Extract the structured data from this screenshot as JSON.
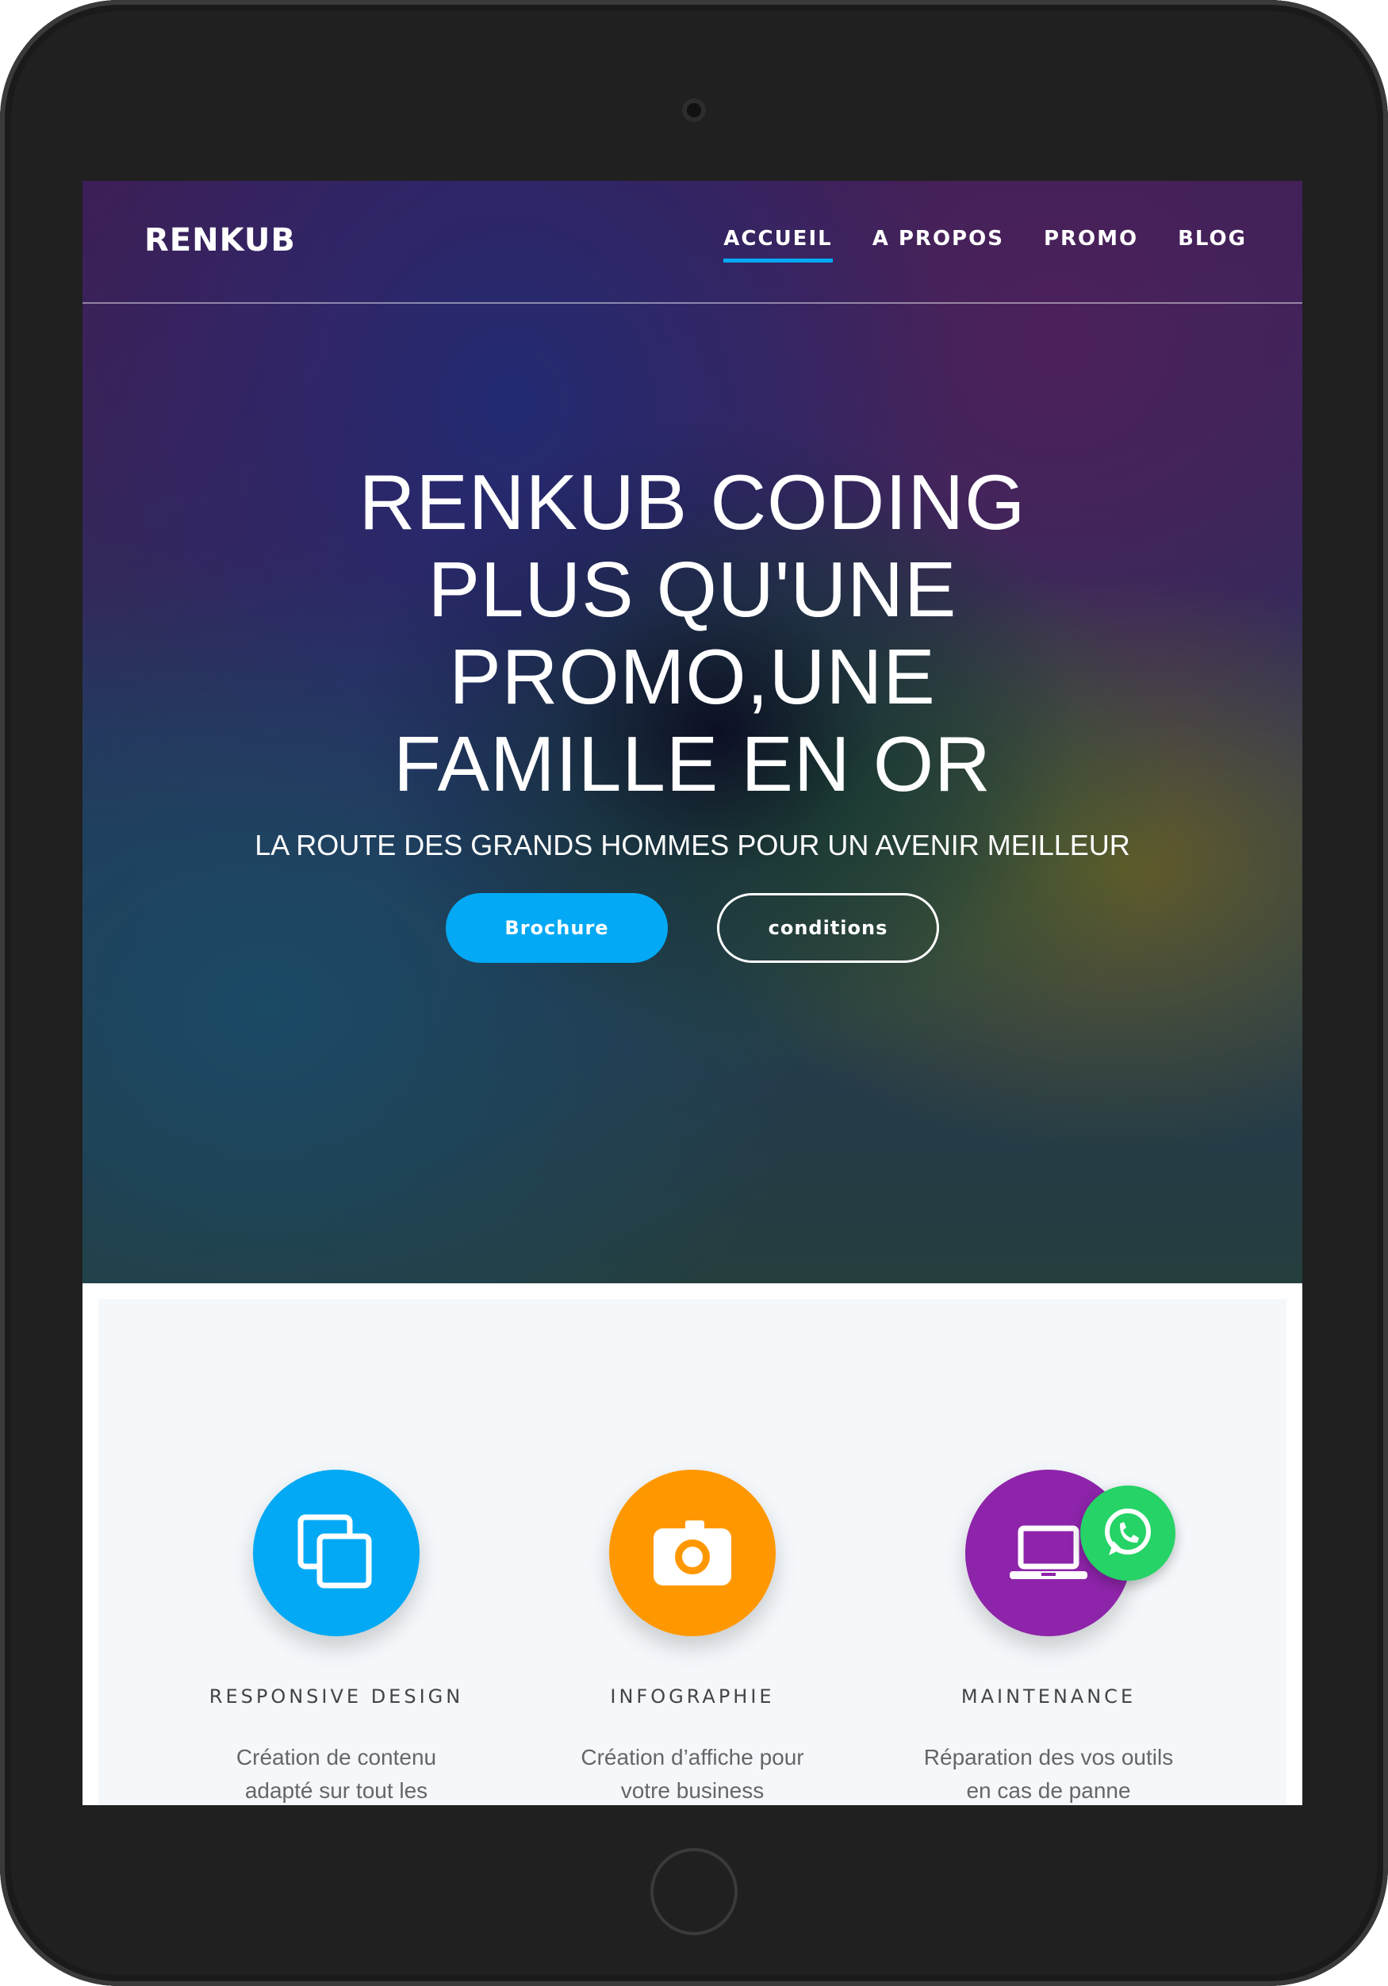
{
  "navbar": {
    "brand": "RENKUB",
    "items": [
      {
        "label": "ACCUEIL",
        "active": true
      },
      {
        "label": "A PROPOS",
        "active": false
      },
      {
        "label": "PROMO",
        "active": false
      },
      {
        "label": "BLOG",
        "active": false
      }
    ]
  },
  "hero": {
    "title_lines": [
      "RENKUB CODING",
      "PLUS QU'UNE",
      "PROMO,UNE",
      "FAMILLE EN OR"
    ],
    "subtitle": "LA ROUTE DES GRANDS HOMMES POUR UN AVENIR MEILLEUR",
    "primary_button": "Brochure",
    "secondary_button": "conditions"
  },
  "features": [
    {
      "title": "RESPONSIVE DESIGN",
      "desc_lines": [
        "Création de contenu",
        "adapté sur tout les"
      ],
      "icon": "copy-icon",
      "color": "#03a9f4"
    },
    {
      "title": "INFOGRAPHIE",
      "desc_lines": [
        "Création d’affiche pour",
        "votre business"
      ],
      "icon": "camera-icon",
      "color": "#ff9800"
    },
    {
      "title": "MAINTENANCE",
      "desc_lines": [
        "Réparation des vos outils",
        "en cas de panne"
      ],
      "icon": "laptop-icon",
      "color": "#8e24aa"
    }
  ],
  "whatsapp": {
    "icon": "whatsapp-icon",
    "color": "#25d366"
  },
  "colors": {
    "accent": "#03a9f4"
  }
}
